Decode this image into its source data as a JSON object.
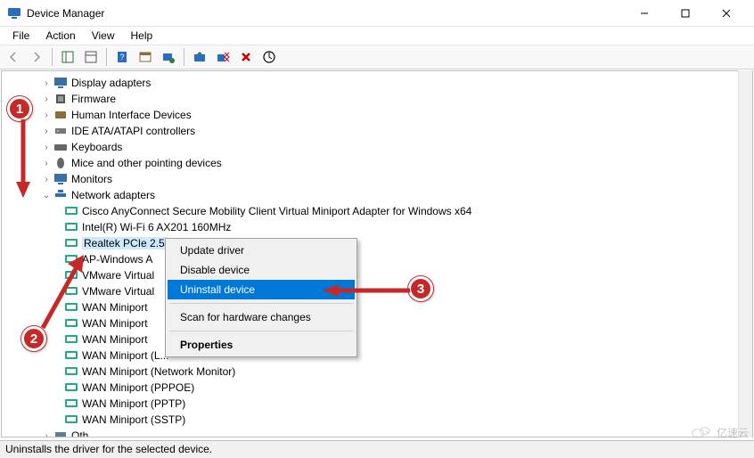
{
  "titlebar": {
    "title": "Device Manager"
  },
  "menubar": {
    "file": "File",
    "action": "Action",
    "view": "View",
    "help": "Help"
  },
  "tree": {
    "items": [
      {
        "label": "Display adapters",
        "icon": "monitor-icon"
      },
      {
        "label": "Firmware",
        "icon": "chip-icon"
      },
      {
        "label": "Human Interface Devices",
        "icon": "hid-icon"
      },
      {
        "label": "IDE ATA/ATAPI controllers",
        "icon": "storage-icon"
      },
      {
        "label": "Keyboards",
        "icon": "keyboard-icon"
      },
      {
        "label": "Mice and other pointing devices",
        "icon": "mouse-icon"
      },
      {
        "label": "Monitors",
        "icon": "monitor-icon"
      },
      {
        "label": "Network adapters",
        "icon": "network-icon",
        "expanded": true
      }
    ],
    "network_children": [
      {
        "label": "Cisco AnyConnect Secure Mobility Client Virtual Miniport Adapter for Windows x64"
      },
      {
        "label": "Intel(R) Wi-Fi 6 AX201 160MHz"
      },
      {
        "label": "Realtek PCIe 2.5",
        "selected": true
      },
      {
        "label": "AP-Windows A"
      },
      {
        "label": "VMware Virtual"
      },
      {
        "label": "VMware Virtual"
      },
      {
        "label": "WAN Miniport"
      },
      {
        "label": "WAN Miniport"
      },
      {
        "label": "WAN Miniport"
      },
      {
        "label": "WAN Miniport (L..."
      },
      {
        "label": "WAN Miniport (Network Monitor)"
      },
      {
        "label": "WAN Miniport (PPPOE)"
      },
      {
        "label": "WAN Miniport (PPTP)"
      },
      {
        "label": "WAN Miniport (SSTP)"
      }
    ],
    "last_category": {
      "label": "Oth"
    }
  },
  "context_menu": {
    "update": "Update driver",
    "disable": "Disable device",
    "uninstall": "Uninstall device",
    "scan": "Scan for hardware changes",
    "properties": "Properties"
  },
  "statusbar": {
    "text": "Uninstalls the driver for the selected device."
  },
  "annotations": {
    "b1": "1",
    "b2": "2",
    "b3": "3"
  },
  "watermark": {
    "text": "亿速云"
  }
}
